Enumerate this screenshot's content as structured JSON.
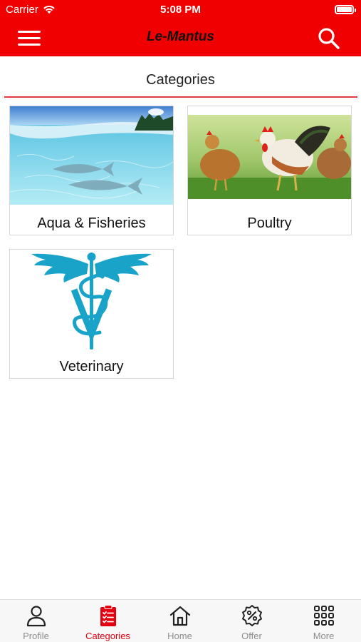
{
  "status_bar": {
    "carrier": "Carrier",
    "time": "5:08 PM"
  },
  "nav": {
    "title": "Le-Mantus",
    "menu_icon": "hamburger-menu-icon",
    "search_icon": "search-icon"
  },
  "header": {
    "title": "Categories"
  },
  "categories": [
    {
      "label": "Aqua & Fisheries",
      "image": "fish-underwater-image"
    },
    {
      "label": "Poultry",
      "image": "chickens-image"
    },
    {
      "label": "Veterinary",
      "image": "veterinary-caduceus-logo"
    }
  ],
  "tabbar": {
    "tabs": [
      {
        "label": "Profile",
        "icon": "person-icon",
        "active": false
      },
      {
        "label": "Categories",
        "icon": "clipboard-list-icon",
        "active": true
      },
      {
        "label": "Home",
        "icon": "home-icon",
        "active": false
      },
      {
        "label": "Offer",
        "icon": "percent-badge-icon",
        "active": false
      },
      {
        "label": "More",
        "icon": "grid-dots-icon",
        "active": false
      }
    ]
  },
  "colors": {
    "brand": "#f00000",
    "active_tab": "#e3000f",
    "divider": "#e33a3a",
    "veterinary_logo": "#1aa3c9"
  }
}
